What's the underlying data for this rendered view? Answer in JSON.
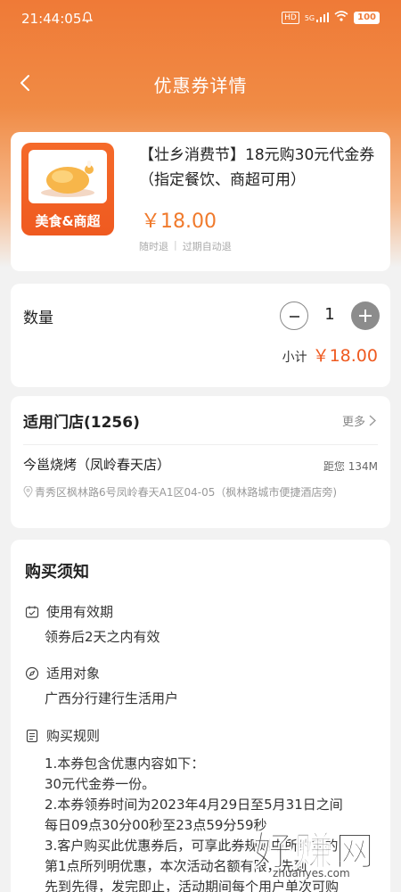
{
  "status_bar": {
    "time": "21:44:05",
    "hd_badge": "HD",
    "signal_label": "5G",
    "battery": "100"
  },
  "header": {
    "title": "优惠券详情"
  },
  "coupon": {
    "image_label": "美食&商超",
    "title": "【壮乡消费节】18元购30元代金券（指定餐饮、商超可用）",
    "price": "￥18.00",
    "tag_1": "随时退",
    "tag_2": "过期自动退"
  },
  "quantity": {
    "label": "数量",
    "value": "1",
    "subtotal_label": "小计",
    "subtotal_value": "￥18.00"
  },
  "stores": {
    "title": "适用门店(1256)",
    "more_label": "更多",
    "store_name": "今邕烧烤（凤岭春天店）",
    "distance": "距您 134M",
    "address": "青秀区枫林路6号凤岭春天A1区04-05（枫林路城市便捷酒店旁)"
  },
  "notice": {
    "title": "购买须知",
    "validity_heading": "使用有效期",
    "validity_body": "领券后2天之内有效",
    "target_heading": "适用对象",
    "target_body": "广西分行建行生活用户",
    "rules_heading": "购买规则",
    "rules_lines": [
      "1.本券包含优惠内容如下：",
      "30元代金券一份。",
      "2.本券领券时间为2023年4月29日至5月31日之间",
      "每日09点30分00秒至23点59分59秒",
      "3.客户购买此优惠券后，可享此券规则中所约定的",
      "第1点所列明优惠，本次活动名额有限，先到",
      "先到先得，发完即止，活动期间每个用户单次可购"
    ]
  },
  "watermark": {
    "text": "好赚网",
    "sub": "zhuanyes.com"
  },
  "colors": {
    "accent": "#f07a2c",
    "price_red": "#ef5a20",
    "header_orange": "#ef7a37"
  }
}
